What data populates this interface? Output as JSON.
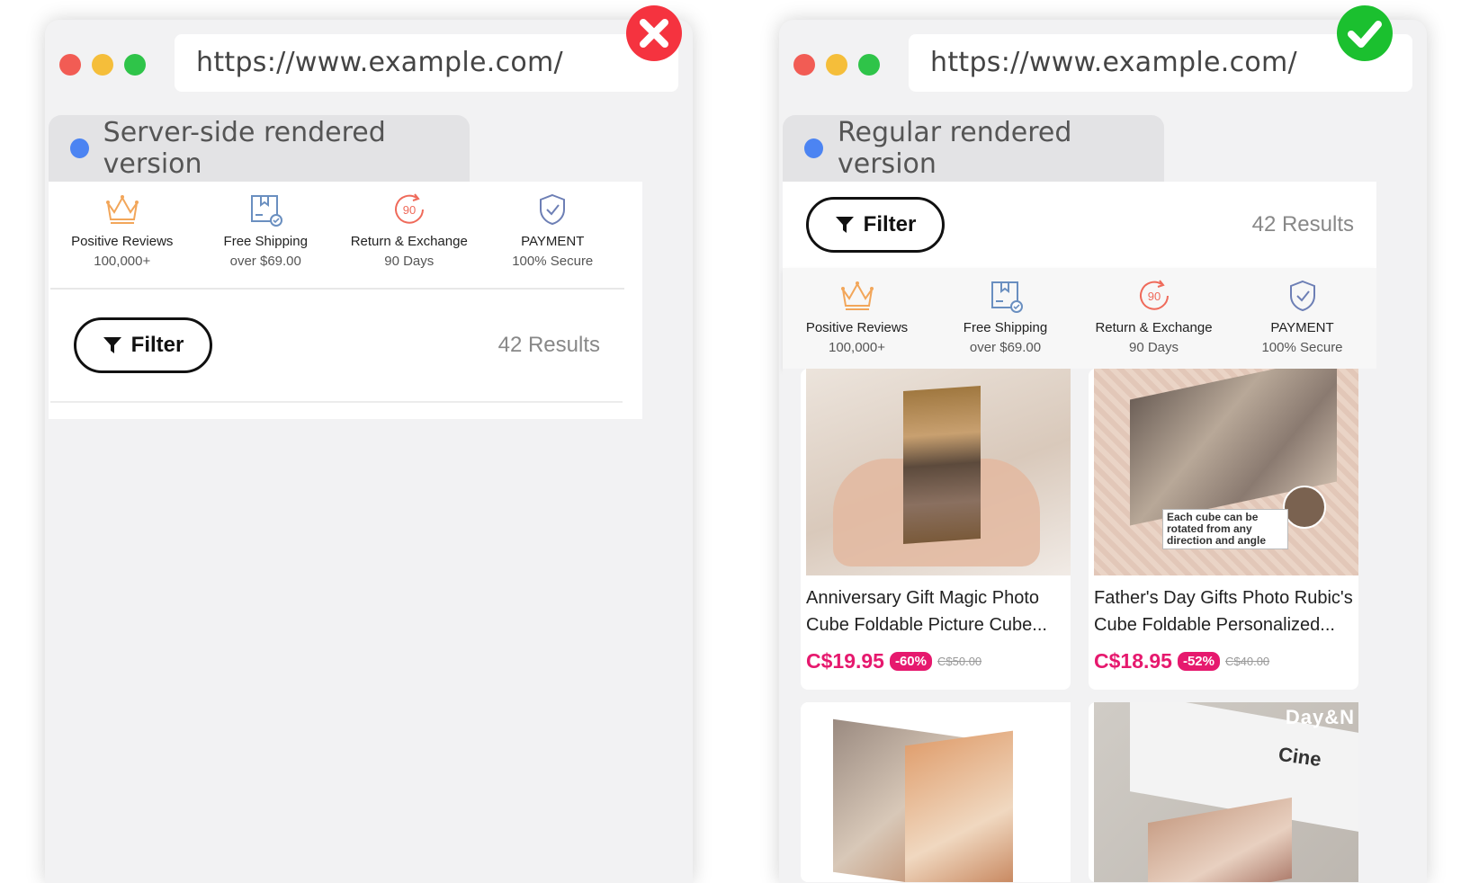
{
  "colors": {
    "dot_red": "#f25c54",
    "dot_yellow": "#f5be3a",
    "dot_green": "#2fc449",
    "tab_dot": "#4c84f2",
    "price": "#e6196e",
    "wrong_mark": "#f5333f",
    "correct_mark": "#1bc02f"
  },
  "left": {
    "url": "https://www.example.com/",
    "tab_label": "Server-side rendered version",
    "status_icon": "x-mark-icon",
    "features": [
      {
        "icon": "crown-icon",
        "title": "Positive Reviews",
        "sub": "100,000+"
      },
      {
        "icon": "shipping-box-icon",
        "title": "Free Shipping",
        "sub": "over $69.00"
      },
      {
        "icon": "return-90-icon",
        "title": "Return & Exchange",
        "sub": "90 Days"
      },
      {
        "icon": "shield-check-icon",
        "title": "PAYMENT",
        "sub": "100% Secure"
      }
    ],
    "filter_label": "Filter",
    "results": "42 Results"
  },
  "right": {
    "url": "https://www.example.com/",
    "tab_label": "Regular rendered version",
    "status_icon": "check-mark-icon",
    "filter_label": "Filter",
    "results": "42 Results",
    "features": [
      {
        "icon": "crown-icon",
        "title": "Positive Reviews",
        "sub": "100,000+"
      },
      {
        "icon": "shipping-box-icon",
        "title": "Free Shipping",
        "sub": "over $69.00"
      },
      {
        "icon": "return-90-icon",
        "title": "Return & Exchange",
        "sub": "90 Days"
      },
      {
        "icon": "shield-check-icon",
        "title": "PAYMENT",
        "sub": "100% Secure"
      }
    ],
    "products": [
      {
        "title": "Anniversary Gift Magic Photo Cube Foldable Picture Cube...",
        "price": "C$19.95",
        "discount": "-60%",
        "old_price": "C$50.00"
      },
      {
        "title": "Father's Day Gifts Photo Rubic's Cube Foldable Personalized...",
        "price": "C$18.95",
        "discount": "-52%",
        "old_price": "C$40.00",
        "image_caption": "Each cube can be rotated from any direction and angle"
      }
    ],
    "product_images_partial": {
      "fourth_text": "Day&N",
      "fourth_logo": "Cine"
    }
  }
}
